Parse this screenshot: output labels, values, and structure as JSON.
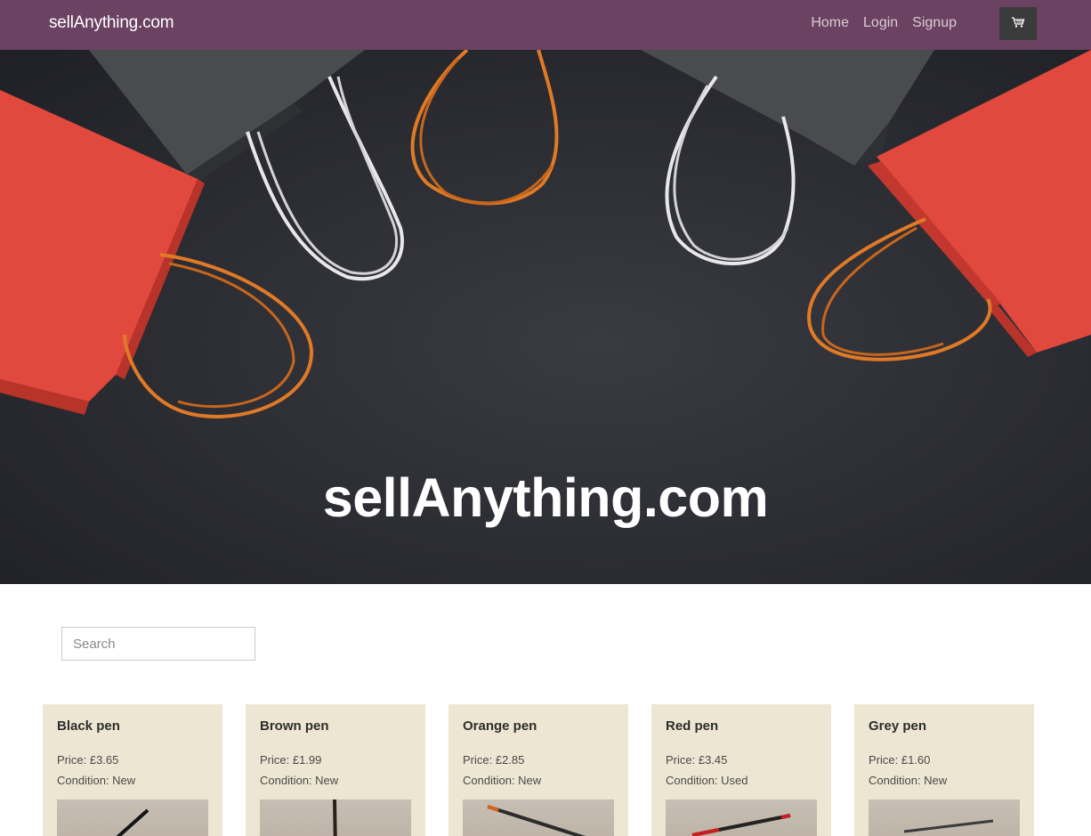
{
  "navbar": {
    "brand": "sellAnything.com",
    "links": [
      "Home",
      "Login",
      "Signup"
    ],
    "cart_icon": "cart-icon"
  },
  "hero": {
    "title": "sellAnything.com"
  },
  "search": {
    "placeholder": "Search",
    "value": ""
  },
  "products": [
    {
      "name": "Black pen",
      "price": "Price: £3.65",
      "condition": "Condition: New"
    },
    {
      "name": "Brown pen",
      "price": "Price: £1.99",
      "condition": "Condition: New"
    },
    {
      "name": "Orange pen",
      "price": "Price: £2.85",
      "condition": "Condition: New"
    },
    {
      "name": "Red pen",
      "price": "Price: £3.45",
      "condition": "Condition: Used"
    },
    {
      "name": "Grey pen",
      "price": "Price: £1.60",
      "condition": "Condition: New"
    }
  ],
  "colors": {
    "navbar": "#6b4261",
    "card": "#ede6d2",
    "cart_button": "#3b3b3b"
  }
}
